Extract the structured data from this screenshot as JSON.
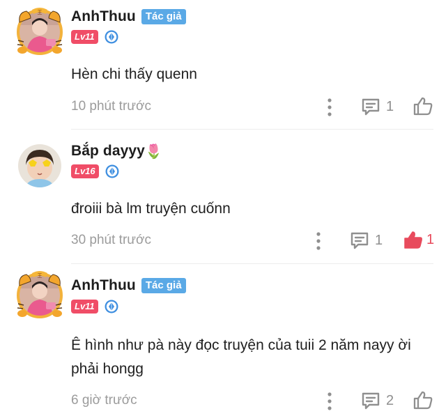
{
  "comments": [
    {
      "user": "AnhThuu",
      "author_badge": "Tác giả",
      "level": "Lv11",
      "text": "Hèn chi thấy quenn",
      "time": "10 phút trước",
      "reply_count": "1",
      "like_count": "",
      "liked": false
    },
    {
      "user": "Bắp dayyy",
      "emoji": "🌷",
      "level": "Lv16",
      "text": "đroiii bà lm truyện cuốnn",
      "time": "30 phút trước",
      "reply_count": "1",
      "like_count": "1",
      "liked": true
    },
    {
      "user": "AnhThuu",
      "author_badge": "Tác giả",
      "level": "Lv11",
      "text": "Ê hình như pà này đọc truyện của tuii 2 năm nayy ời phải hongg",
      "time": "6 giờ trước",
      "reply_count": "2",
      "like_count": "",
      "liked": false
    }
  ],
  "colors": {
    "accent_badge": "#5aa9e6",
    "level_badge": "#f04d67",
    "liked": "#e84b5d",
    "muted": "#9b9b9b"
  },
  "icons": [
    "tiger-frame-icon",
    "level-crystal-icon",
    "more-icon",
    "comment-icon",
    "thumbs-up-icon"
  ]
}
